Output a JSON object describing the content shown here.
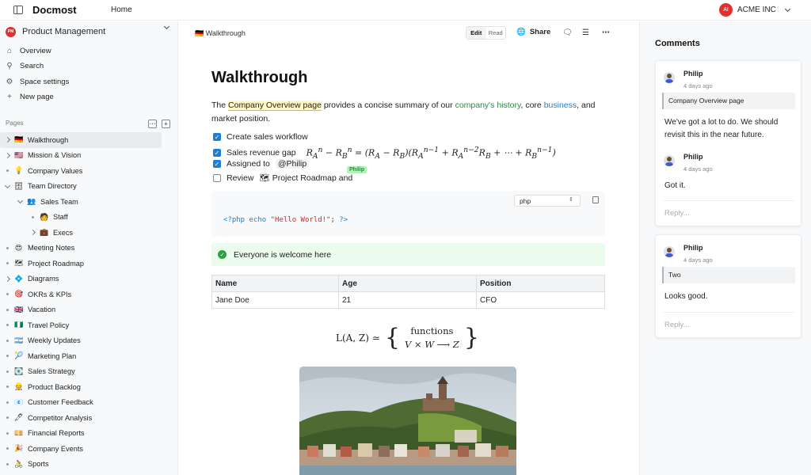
{
  "topbar": {
    "brand": "Docmost",
    "home": "Home",
    "org_initials": "AI",
    "org_name": "ACME INC"
  },
  "sidebar": {
    "space_initials": "PM",
    "space_name": "Product Management",
    "nav": [
      {
        "icon": "home-icon",
        "glyph": "⌂",
        "label": "Overview"
      },
      {
        "icon": "search-icon",
        "glyph": "⚲",
        "label": "Search"
      },
      {
        "icon": "gear-icon",
        "glyph": "⚙",
        "label": "Space settings"
      },
      {
        "icon": "plus-icon",
        "glyph": "+",
        "label": "New page"
      }
    ],
    "pages_label": "Pages",
    "tree": [
      {
        "label": "Walkthrough",
        "emoji": "🇩🇪",
        "depth": 0,
        "caret": "r",
        "selected": true
      },
      {
        "label": "Mission & Vision",
        "emoji": "🇺🇸",
        "depth": 0,
        "caret": "r"
      },
      {
        "label": "Company Values",
        "emoji": "💡",
        "depth": 0,
        "caret": "dot"
      },
      {
        "label": "Team Directory",
        "emoji": "🗄",
        "depth": 0,
        "caret": "d"
      },
      {
        "label": "Sales Team",
        "emoji": "👥",
        "depth": 1,
        "caret": "d"
      },
      {
        "label": "Staff",
        "emoji": "🧑",
        "depth": 2,
        "caret": "dot"
      },
      {
        "label": "Execs",
        "emoji": "💼",
        "depth": 2,
        "caret": "r"
      },
      {
        "label": "Meeting Notes",
        "emoji": "😍",
        "depth": 0,
        "caret": "dot"
      },
      {
        "label": "Project Roadmap",
        "emoji": "🗺",
        "depth": 0,
        "caret": "dot"
      },
      {
        "label": "Diagrams",
        "emoji": "💠",
        "depth": 0,
        "caret": "r"
      },
      {
        "label": "OKRs & KPIs",
        "emoji": "🎯",
        "depth": 0,
        "caret": "dot"
      },
      {
        "label": "Vacation",
        "emoji": "🇬🇧",
        "depth": 0,
        "caret": "dot"
      },
      {
        "label": "Travel Policy",
        "emoji": "🇳🇬",
        "depth": 0,
        "caret": "dot"
      },
      {
        "label": "Weekly Updates",
        "emoji": "🇦🇷",
        "depth": 0,
        "caret": "dot"
      },
      {
        "label": "Marketing Plan",
        "emoji": "🎾",
        "depth": 0,
        "caret": "dot"
      },
      {
        "label": "Sales Strategy",
        "emoji": "💽",
        "depth": 0,
        "caret": "dot"
      },
      {
        "label": "Product Backlog",
        "emoji": "👷",
        "depth": 0,
        "caret": "dot"
      },
      {
        "label": "Customer Feedback",
        "emoji": "📧",
        "depth": 0,
        "caret": "dot"
      },
      {
        "label": "Competitor Analysis",
        "emoji": "🖊",
        "depth": 0,
        "caret": "dot"
      },
      {
        "label": "Financial Reports",
        "emoji": "💴",
        "depth": 0,
        "caret": "dot"
      },
      {
        "label": "Company Events",
        "emoji": "🎉",
        "depth": 0,
        "caret": "dot"
      },
      {
        "label": "Sports",
        "emoji": "🚴",
        "depth": 0,
        "caret": "dot"
      }
    ]
  },
  "header": {
    "crumb_emoji": "🇩🇪",
    "crumb": "Walkthrough",
    "edit": "Edit",
    "read": "Read",
    "share": "Share"
  },
  "doc": {
    "title": "Walkthrough",
    "p1": "The ",
    "link1": "Company Overview page",
    "p2": " provides a concise summary of our ",
    "link2": "company's history",
    "p3": ", core ",
    "link3": "business",
    "p4": ", and market position.",
    "todos": [
      {
        "label": "Create sales workflow",
        "checked": true
      },
      {
        "label": "Sales revenue gap",
        "checked": true
      },
      {
        "label": "Assigned to",
        "checked": true,
        "mention": "@Philip"
      },
      {
        "label": "Review",
        "checked": false,
        "link_emoji": "🗺",
        "link": "Project Roadmap and"
      }
    ],
    "philip_tag": "Philip",
    "code_lang": "php",
    "code_open": "<?php echo ",
    "code_string": "\"Hello World!\"",
    "code_semi": ";",
    "code_close": " ?>",
    "callout": "Everyone is welcome here",
    "table": {
      "headers": [
        "Name",
        "Age",
        "Position"
      ],
      "rows": [
        [
          "Jane Doe",
          "21",
          "CFO"
        ]
      ]
    },
    "eq_left": "L(A, Z) ≃",
    "eq_top": "functions",
    "eq_bottom": "V × W ⟶ Z"
  },
  "comments": {
    "title": "Comments",
    "threads": [
      {
        "quote": "Company Overview page",
        "items": [
          {
            "author": "Philip",
            "time": "4 days ago",
            "text": "We've got a lot to do. We should revisit this in the near future."
          },
          {
            "author": "Philip",
            "time": "4 days ago",
            "text": "Got it."
          }
        ],
        "reply": "Reply..."
      },
      {
        "quote": "Two",
        "items": [
          {
            "author": "Philip",
            "time": "4 days ago",
            "text": "Looks good."
          }
        ],
        "reply": "Reply..."
      }
    ]
  }
}
